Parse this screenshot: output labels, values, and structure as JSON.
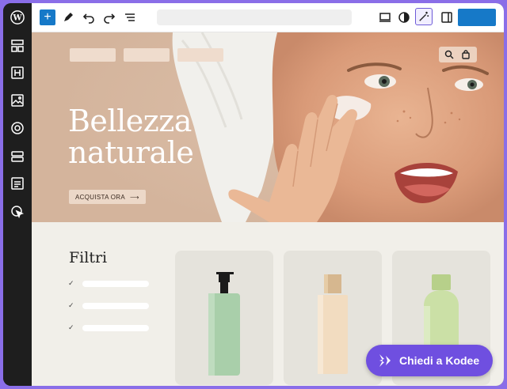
{
  "toolbar": {
    "document_title": "",
    "save_label": ""
  },
  "hero": {
    "headline_line1": "Bellezza",
    "headline_line2": "naturale",
    "cta_label": "ACQUISTA ORA",
    "cta_arrow": "⟶"
  },
  "shop": {
    "filters_title": "Filtri",
    "filters": [
      {
        "checked": true,
        "label": ""
      },
      {
        "checked": true,
        "label": ""
      },
      {
        "checked": true,
        "label": ""
      }
    ],
    "check_mark": "✓"
  },
  "assistant": {
    "label": "Chiedi a Kodee"
  },
  "colors": {
    "accent": "#1679c8",
    "assistant": "#6f4fe0",
    "frame": "#8a6ee8"
  },
  "icons": [
    "wordpress-logo-icon",
    "plus-icon",
    "pen-icon",
    "undo-icon",
    "redo-icon",
    "list-view-icon",
    "desktop-icon",
    "contrast-icon",
    "magic-wand-icon",
    "sidebar-icon",
    "patterns-icon",
    "heading-icon",
    "image-icon",
    "target-icon",
    "layout-icon",
    "form-icon",
    "pointer-icon",
    "search-icon",
    "bag-icon",
    "sparkle-icon"
  ]
}
